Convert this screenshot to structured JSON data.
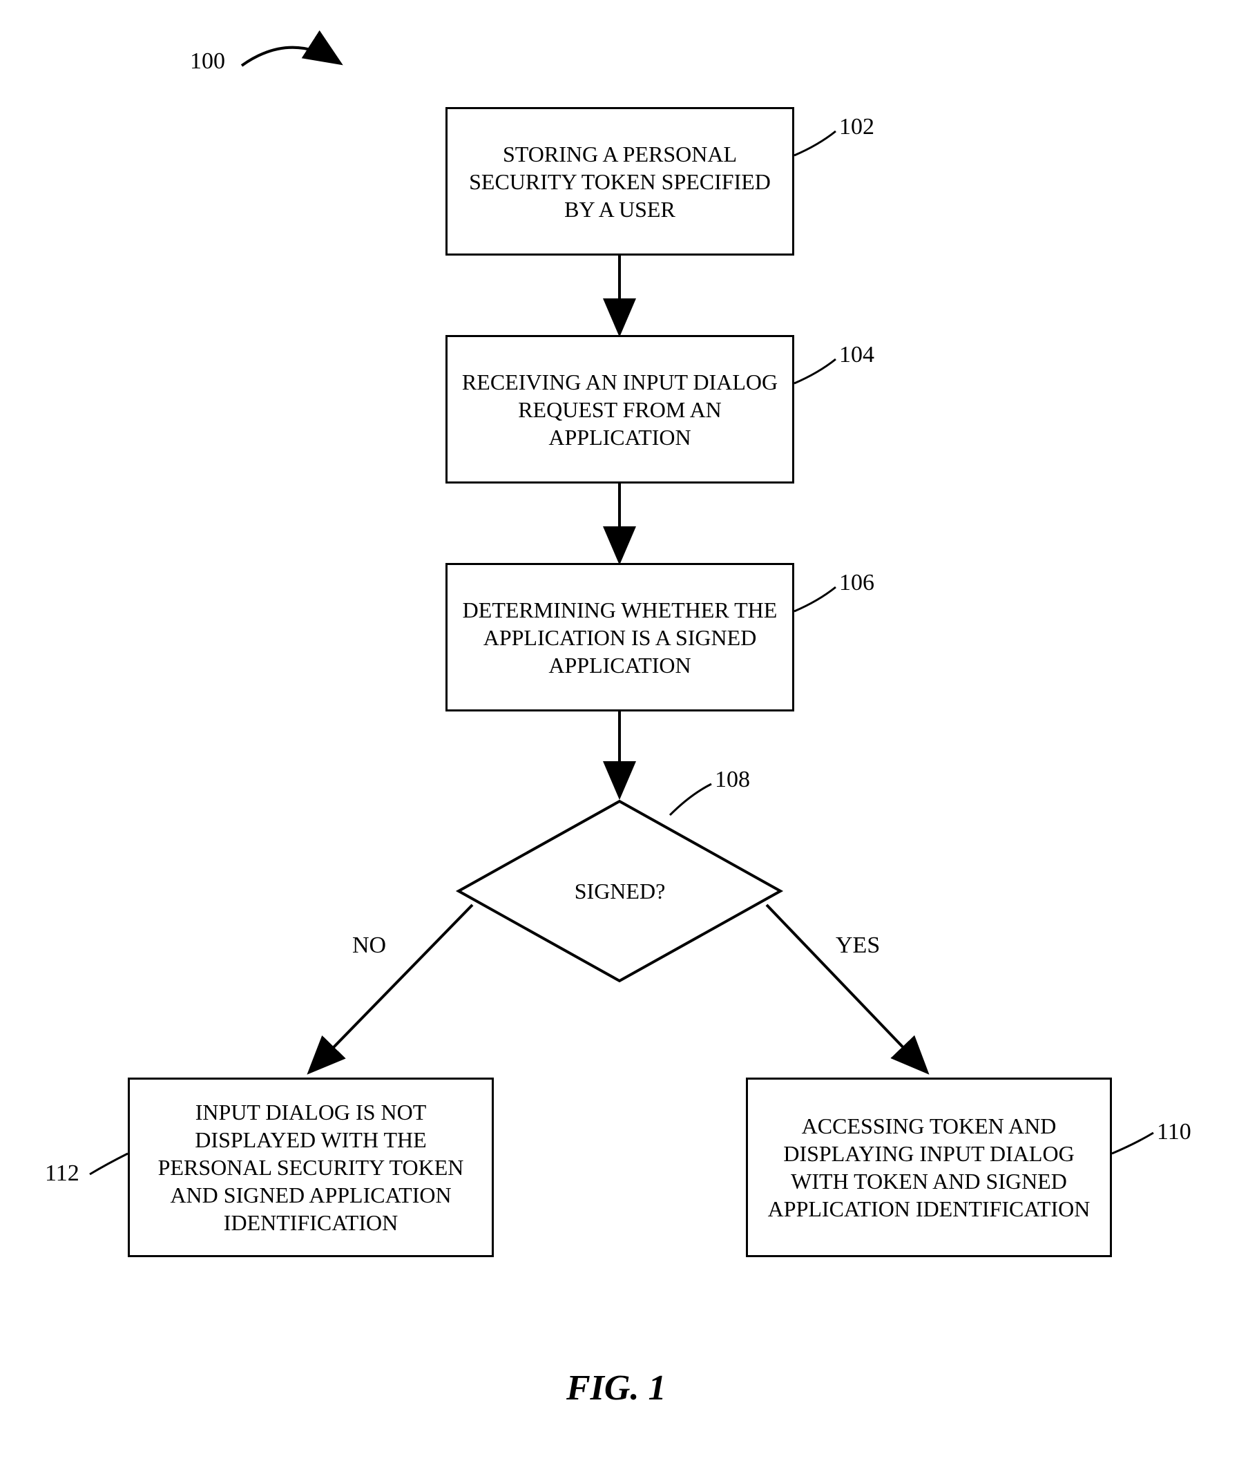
{
  "figure": {
    "ref": "100",
    "title": "FIG. 1"
  },
  "nodes": {
    "n102": {
      "text": "STORING A PERSONAL SECURITY TOKEN SPECIFIED BY A USER",
      "ref": "102"
    },
    "n104": {
      "text": "RECEIVING AN INPUT DIALOG REQUEST FROM AN APPLICATION",
      "ref": "104"
    },
    "n106": {
      "text": "DETERMINING WHETHER THE APPLICATION IS A SIGNED APPLICATION",
      "ref": "106"
    },
    "n108": {
      "text": "SIGNED?",
      "ref": "108"
    },
    "n110": {
      "text": "ACCESSING TOKEN AND DISPLAYING INPUT DIALOG WITH TOKEN AND SIGNED APPLICATION IDENTIFICATION",
      "ref": "110"
    },
    "n112": {
      "text": "INPUT DIALOG IS NOT DISPLAYED WITH THE PERSONAL SECURITY TOKEN AND SIGNED APPLICATION IDENTIFICATION",
      "ref": "112"
    }
  },
  "edges": {
    "no": "NO",
    "yes": "YES"
  }
}
